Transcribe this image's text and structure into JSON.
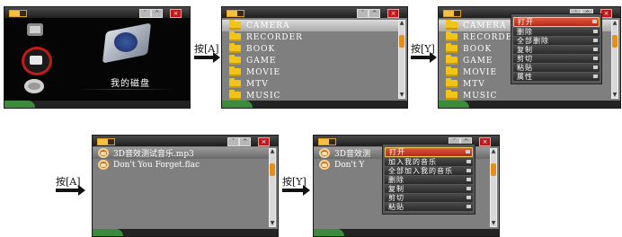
{
  "arrows": [
    "按[A]",
    "按[Y]",
    "按[A]",
    "按[Y]"
  ],
  "screen1": {
    "caption": "我的磁盘"
  },
  "screen2": {
    "folders": [
      "CAMERA",
      "RECORDER",
      "BOOK",
      "GAME",
      "MOVIE",
      "MTV",
      "MUSIC"
    ]
  },
  "screen3": {
    "folders": [
      "CAMERA",
      "RECORDE",
      "BOOK",
      "GAME",
      "MOVIE",
      "MTV",
      "MUSIC"
    ],
    "menu": [
      "打开",
      "删除",
      "全部删除",
      "复制",
      "剪切",
      "粘贴",
      "属性"
    ]
  },
  "screen4": {
    "files": [
      "3D音效测试音乐.mp3",
      "Don't You Forget.flac"
    ]
  },
  "screen5": {
    "files": [
      "3D音效测",
      "Don't Y"
    ],
    "menu": [
      "打开",
      "加入我的音乐",
      "全部加入我的音乐",
      "删除",
      "复制",
      "剪切",
      "粘贴"
    ]
  },
  "colors": {
    "screen_bg": "#7f7f7f",
    "accent_orange": "#e58e1a",
    "close_red": "#c4151b",
    "folder_yellow": "#f2c418"
  }
}
